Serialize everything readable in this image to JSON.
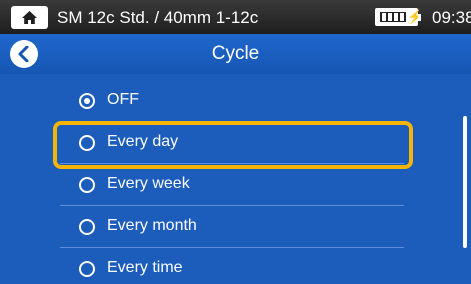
{
  "status_bar": {
    "path": "SM 12c Std. / 40mm 1-12c",
    "time": "09:38",
    "home_icon": "home-icon",
    "battery_icon": "battery-charging-icon"
  },
  "header": {
    "title": "Cycle",
    "back_icon": "back-arrow-icon"
  },
  "options": [
    {
      "label": "OFF",
      "selected": true
    },
    {
      "label": "Every day",
      "selected": false,
      "highlighted": true
    },
    {
      "label": "Every week",
      "selected": false
    },
    {
      "label": "Every month",
      "selected": false
    },
    {
      "label": "Every time",
      "selected": false
    }
  ],
  "colors": {
    "background": "#1c5cbb",
    "highlight": "#f5b400",
    "status_bar": "#2a2a2a"
  }
}
